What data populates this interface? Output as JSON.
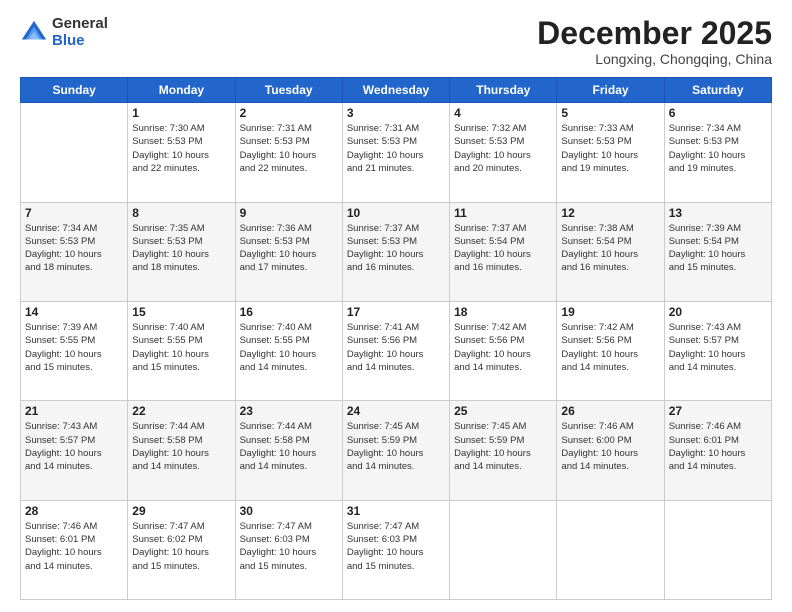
{
  "logo": {
    "general": "General",
    "blue": "Blue"
  },
  "header": {
    "month": "December 2025",
    "location": "Longxing, Chongqing, China"
  },
  "weekdays": [
    "Sunday",
    "Monday",
    "Tuesday",
    "Wednesday",
    "Thursday",
    "Friday",
    "Saturday"
  ],
  "weeks": [
    [
      {
        "day": "",
        "info": ""
      },
      {
        "day": "1",
        "info": "Sunrise: 7:30 AM\nSunset: 5:53 PM\nDaylight: 10 hours\nand 22 minutes."
      },
      {
        "day": "2",
        "info": "Sunrise: 7:31 AM\nSunset: 5:53 PM\nDaylight: 10 hours\nand 22 minutes."
      },
      {
        "day": "3",
        "info": "Sunrise: 7:31 AM\nSunset: 5:53 PM\nDaylight: 10 hours\nand 21 minutes."
      },
      {
        "day": "4",
        "info": "Sunrise: 7:32 AM\nSunset: 5:53 PM\nDaylight: 10 hours\nand 20 minutes."
      },
      {
        "day": "5",
        "info": "Sunrise: 7:33 AM\nSunset: 5:53 PM\nDaylight: 10 hours\nand 19 minutes."
      },
      {
        "day": "6",
        "info": "Sunrise: 7:34 AM\nSunset: 5:53 PM\nDaylight: 10 hours\nand 19 minutes."
      }
    ],
    [
      {
        "day": "7",
        "info": "Sunrise: 7:34 AM\nSunset: 5:53 PM\nDaylight: 10 hours\nand 18 minutes."
      },
      {
        "day": "8",
        "info": "Sunrise: 7:35 AM\nSunset: 5:53 PM\nDaylight: 10 hours\nand 18 minutes."
      },
      {
        "day": "9",
        "info": "Sunrise: 7:36 AM\nSunset: 5:53 PM\nDaylight: 10 hours\nand 17 minutes."
      },
      {
        "day": "10",
        "info": "Sunrise: 7:37 AM\nSunset: 5:53 PM\nDaylight: 10 hours\nand 16 minutes."
      },
      {
        "day": "11",
        "info": "Sunrise: 7:37 AM\nSunset: 5:54 PM\nDaylight: 10 hours\nand 16 minutes."
      },
      {
        "day": "12",
        "info": "Sunrise: 7:38 AM\nSunset: 5:54 PM\nDaylight: 10 hours\nand 16 minutes."
      },
      {
        "day": "13",
        "info": "Sunrise: 7:39 AM\nSunset: 5:54 PM\nDaylight: 10 hours\nand 15 minutes."
      }
    ],
    [
      {
        "day": "14",
        "info": "Sunrise: 7:39 AM\nSunset: 5:55 PM\nDaylight: 10 hours\nand 15 minutes."
      },
      {
        "day": "15",
        "info": "Sunrise: 7:40 AM\nSunset: 5:55 PM\nDaylight: 10 hours\nand 15 minutes."
      },
      {
        "day": "16",
        "info": "Sunrise: 7:40 AM\nSunset: 5:55 PM\nDaylight: 10 hours\nand 14 minutes."
      },
      {
        "day": "17",
        "info": "Sunrise: 7:41 AM\nSunset: 5:56 PM\nDaylight: 10 hours\nand 14 minutes."
      },
      {
        "day": "18",
        "info": "Sunrise: 7:42 AM\nSunset: 5:56 PM\nDaylight: 10 hours\nand 14 minutes."
      },
      {
        "day": "19",
        "info": "Sunrise: 7:42 AM\nSunset: 5:56 PM\nDaylight: 10 hours\nand 14 minutes."
      },
      {
        "day": "20",
        "info": "Sunrise: 7:43 AM\nSunset: 5:57 PM\nDaylight: 10 hours\nand 14 minutes."
      }
    ],
    [
      {
        "day": "21",
        "info": "Sunrise: 7:43 AM\nSunset: 5:57 PM\nDaylight: 10 hours\nand 14 minutes."
      },
      {
        "day": "22",
        "info": "Sunrise: 7:44 AM\nSunset: 5:58 PM\nDaylight: 10 hours\nand 14 minutes."
      },
      {
        "day": "23",
        "info": "Sunrise: 7:44 AM\nSunset: 5:58 PM\nDaylight: 10 hours\nand 14 minutes."
      },
      {
        "day": "24",
        "info": "Sunrise: 7:45 AM\nSunset: 5:59 PM\nDaylight: 10 hours\nand 14 minutes."
      },
      {
        "day": "25",
        "info": "Sunrise: 7:45 AM\nSunset: 5:59 PM\nDaylight: 10 hours\nand 14 minutes."
      },
      {
        "day": "26",
        "info": "Sunrise: 7:46 AM\nSunset: 6:00 PM\nDaylight: 10 hours\nand 14 minutes."
      },
      {
        "day": "27",
        "info": "Sunrise: 7:46 AM\nSunset: 6:01 PM\nDaylight: 10 hours\nand 14 minutes."
      }
    ],
    [
      {
        "day": "28",
        "info": "Sunrise: 7:46 AM\nSunset: 6:01 PM\nDaylight: 10 hours\nand 14 minutes."
      },
      {
        "day": "29",
        "info": "Sunrise: 7:47 AM\nSunset: 6:02 PM\nDaylight: 10 hours\nand 15 minutes."
      },
      {
        "day": "30",
        "info": "Sunrise: 7:47 AM\nSunset: 6:03 PM\nDaylight: 10 hours\nand 15 minutes."
      },
      {
        "day": "31",
        "info": "Sunrise: 7:47 AM\nSunset: 6:03 PM\nDaylight: 10 hours\nand 15 minutes."
      },
      {
        "day": "",
        "info": ""
      },
      {
        "day": "",
        "info": ""
      },
      {
        "day": "",
        "info": ""
      }
    ]
  ]
}
